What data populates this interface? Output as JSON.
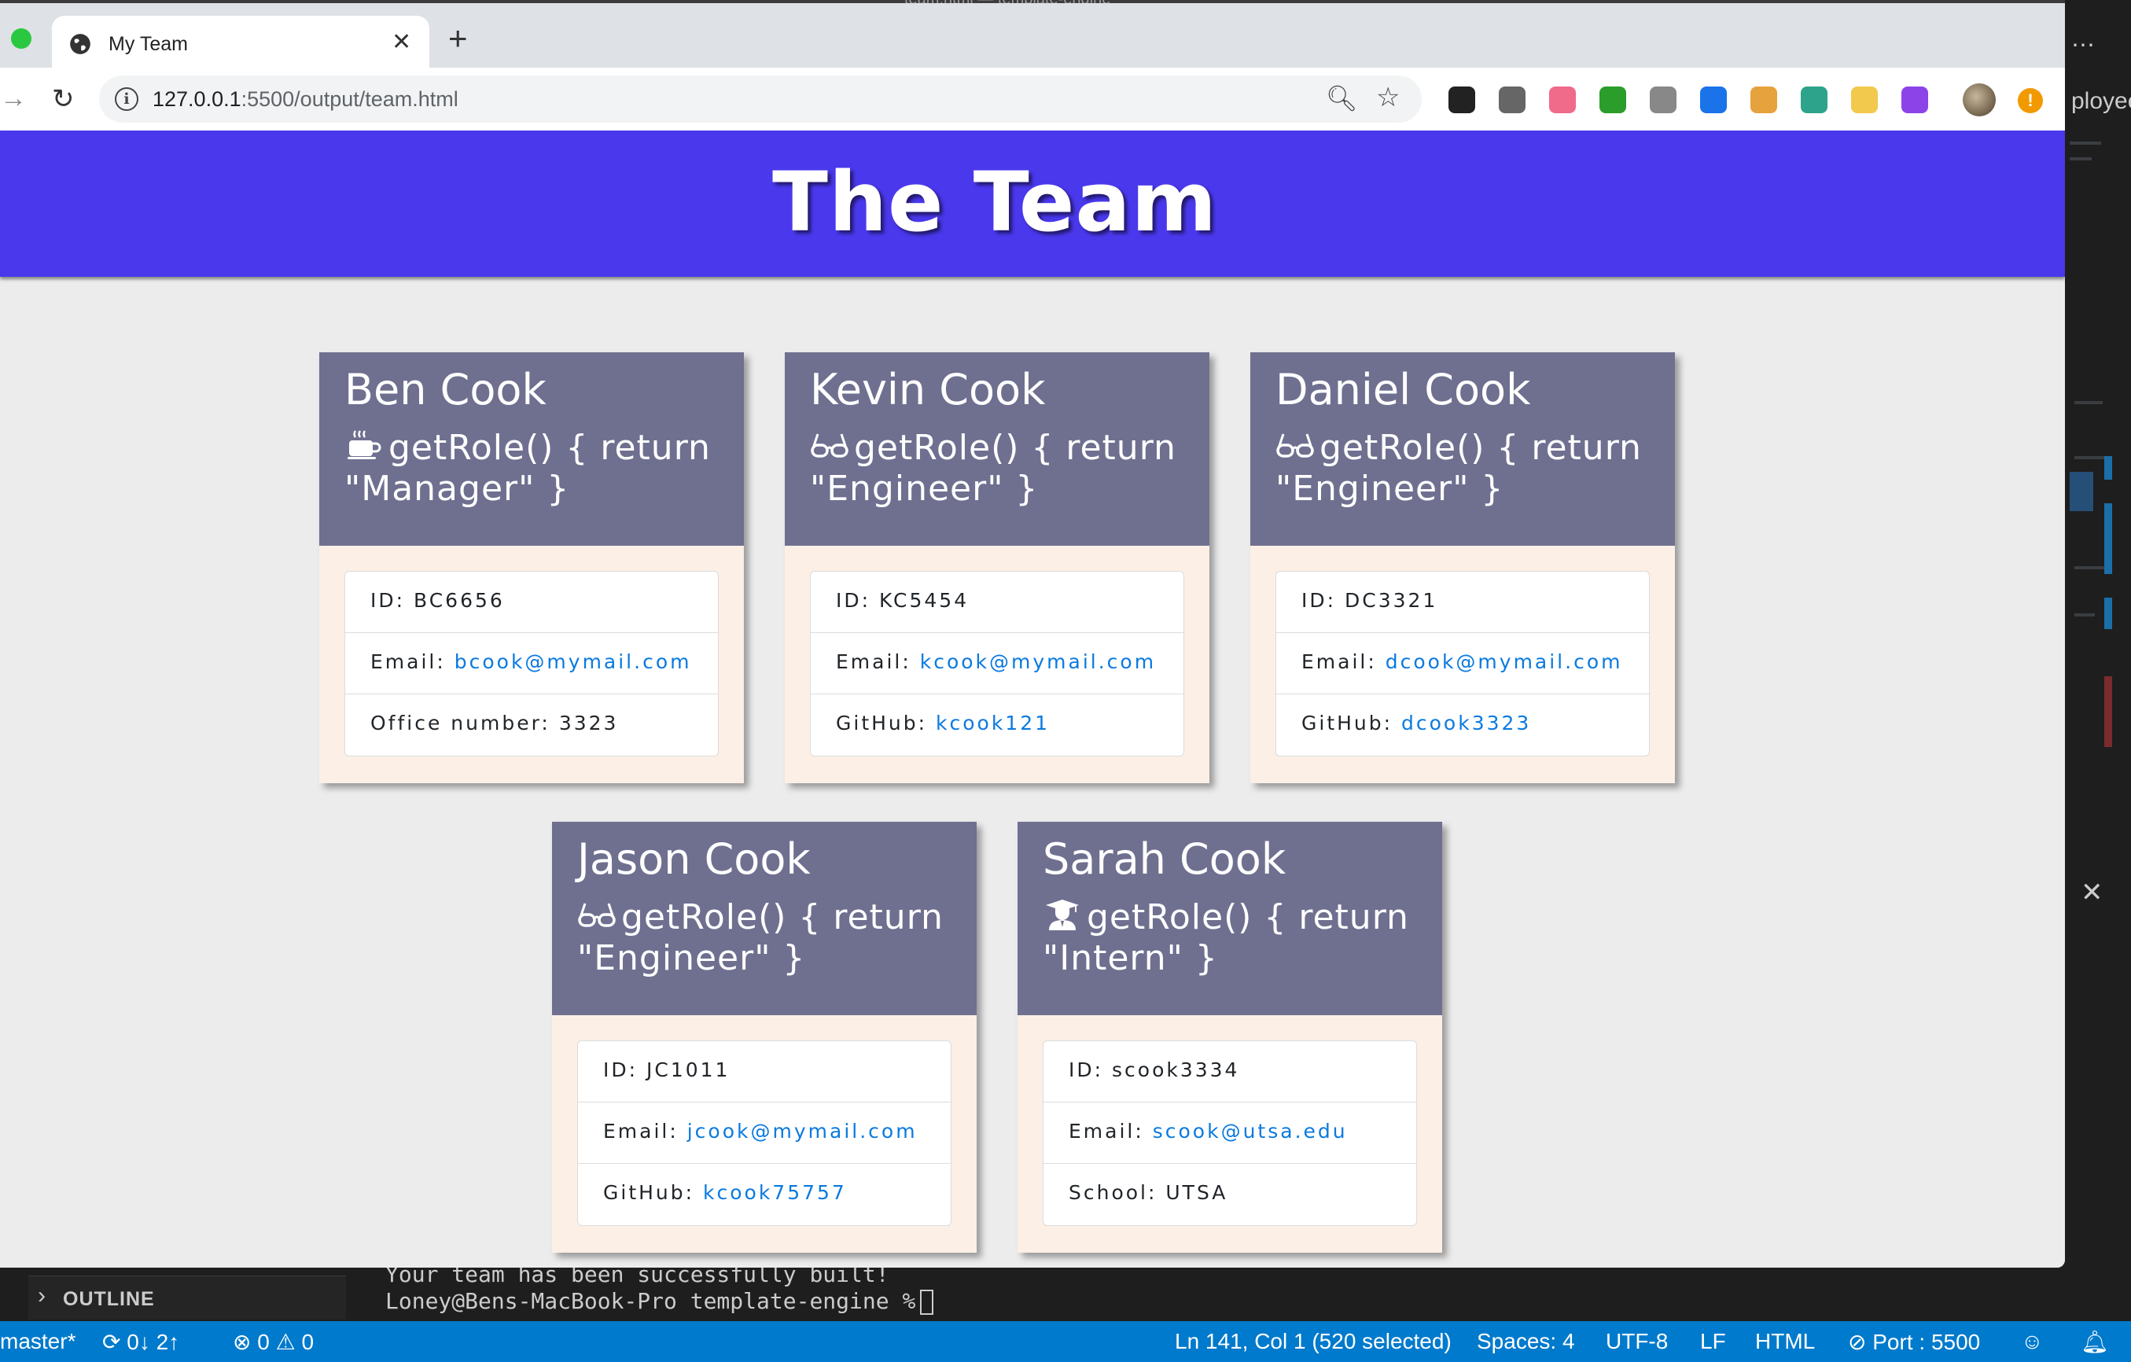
{
  "vscode": {
    "title_fragment": "team.html — template-engine",
    "right_cut_text": "ployee",
    "outline_label": "OUTLINE",
    "terminal_line1": "Your team has been successfully built!",
    "terminal_line2": "Loney@Bens-MacBook-Pro template-engine %",
    "status": {
      "branch": "master*",
      "sync": "0↓ 2↑",
      "problems": "0",
      "warnings": "0",
      "cursor": "Ln 141, Col 1 (520 selected)",
      "spaces": "Spaces: 4",
      "encoding": "UTF-8",
      "eol": "LF",
      "language": "HTML",
      "port": "Port : 5500"
    }
  },
  "browser": {
    "tab_title": "My Team",
    "url_host": "127.0.0.1",
    "url_path": ":5500/output/team.html",
    "extension_colors": [
      "#222222",
      "#666666",
      "#f06a8a",
      "#2a9d2a",
      "#888888",
      "#1a73e8",
      "#e6a23c",
      "#2ea38b",
      "#f2c94c",
      "#8c44e8"
    ]
  },
  "page": {
    "heading": "The Team",
    "colors": {
      "header_bg": "#4a38ed",
      "card_header_bg": "#6f7090",
      "card_body_bg": "#fbefe6",
      "link": "#0a7ae0"
    },
    "cards": [
      {
        "name": "Ben Cook",
        "icon": "coffee-icon",
        "role": "getRole() { return \"Manager\" }",
        "id_label": "ID: ",
        "id": "BC6656",
        "email_label": "Email: ",
        "email": "bcook@mymail.com",
        "extra_label": "Office number: ",
        "extra": "3323"
      },
      {
        "name": "Kevin Cook",
        "icon": "glasses-icon",
        "role": "getRole() { return \"Engineer\" }",
        "id_label": "ID: ",
        "id": "KC5454",
        "email_label": "Email: ",
        "email": "kcook@mymail.com",
        "extra_label": "GitHub: ",
        "extra": "kcook121"
      },
      {
        "name": "Daniel Cook",
        "icon": "glasses-icon",
        "role": "getRole() { return \"Engineer\" }",
        "id_label": "ID: ",
        "id": "DC3321",
        "email_label": "Email: ",
        "email": "dcook@mymail.com",
        "extra_label": "GitHub: ",
        "extra": "dcook3323"
      },
      {
        "name": "Jason Cook",
        "icon": "glasses-icon",
        "role": "getRole() { return \"Engineer\" }",
        "id_label": "ID: ",
        "id": "JC1011",
        "email_label": "Email: ",
        "email": "jcook@mymail.com",
        "extra_label": "GitHub: ",
        "extra": "kcook75757"
      },
      {
        "name": "Sarah Cook",
        "icon": "graduate-icon",
        "role": "getRole() { return \"Intern\" }",
        "id_label": "ID: ",
        "id": "scook3334",
        "email_label": "Email: ",
        "email": "scook@utsa.edu",
        "extra_label": "School: ",
        "extra": "UTSA"
      }
    ]
  }
}
